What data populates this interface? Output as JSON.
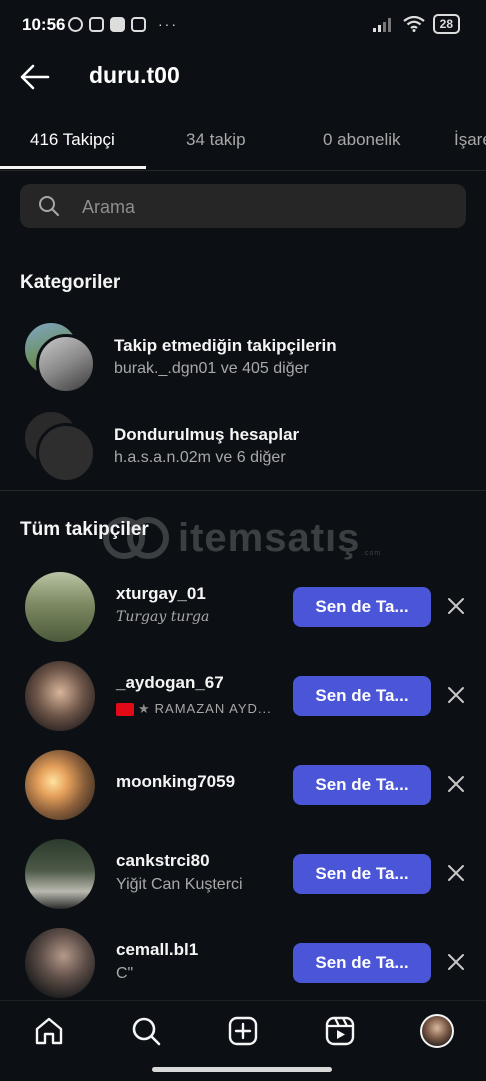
{
  "status_bar": {
    "time": "10:56",
    "dots": "···",
    "battery": "28"
  },
  "header": {
    "back_icon": "arrow-left-icon",
    "username": "duru.t00"
  },
  "tabs": [
    {
      "label": "416 Takipçi",
      "active": true
    },
    {
      "label": "34 takip",
      "active": false
    },
    {
      "label": "0 abonelik",
      "active": false
    },
    {
      "label": "İşaretli",
      "active": false
    }
  ],
  "search": {
    "placeholder": "Arama"
  },
  "categories_section": {
    "title": "Kategoriler",
    "items": [
      {
        "title": "Takip etmediğin takipçilerin",
        "subtitle": "burak._.dgn01 ve 405 diğer"
      },
      {
        "title": "Dondurulmuş hesaplar",
        "subtitle": "h.a.s.a.n.02m ve 6 diğer"
      }
    ]
  },
  "followers_section": {
    "title": "Tüm takipçiler",
    "follow_label": "Sen de Ta...",
    "rows": [
      {
        "username": "xturgay_01",
        "name": "Turgay turga"
      },
      {
        "username": "_aydogan_67",
        "name": "RAMAZAN AYD..."
      },
      {
        "username": "moonking7059",
        "name": ""
      },
      {
        "username": "cankstrci80",
        "name": "Yiğit Can Kuşterci"
      },
      {
        "username": "cemall.bl1",
        "name": "C\""
      }
    ]
  },
  "watermark": {
    "text": "itemsatış",
    "sub": ".com"
  },
  "colors": {
    "background": "#0c1014",
    "follow_button": "#4a55d8",
    "secondary_text": "#a8a8a8"
  },
  "bottom_nav": [
    "home-icon",
    "search-icon",
    "create-icon",
    "reels-icon",
    "profile-avatar"
  ]
}
